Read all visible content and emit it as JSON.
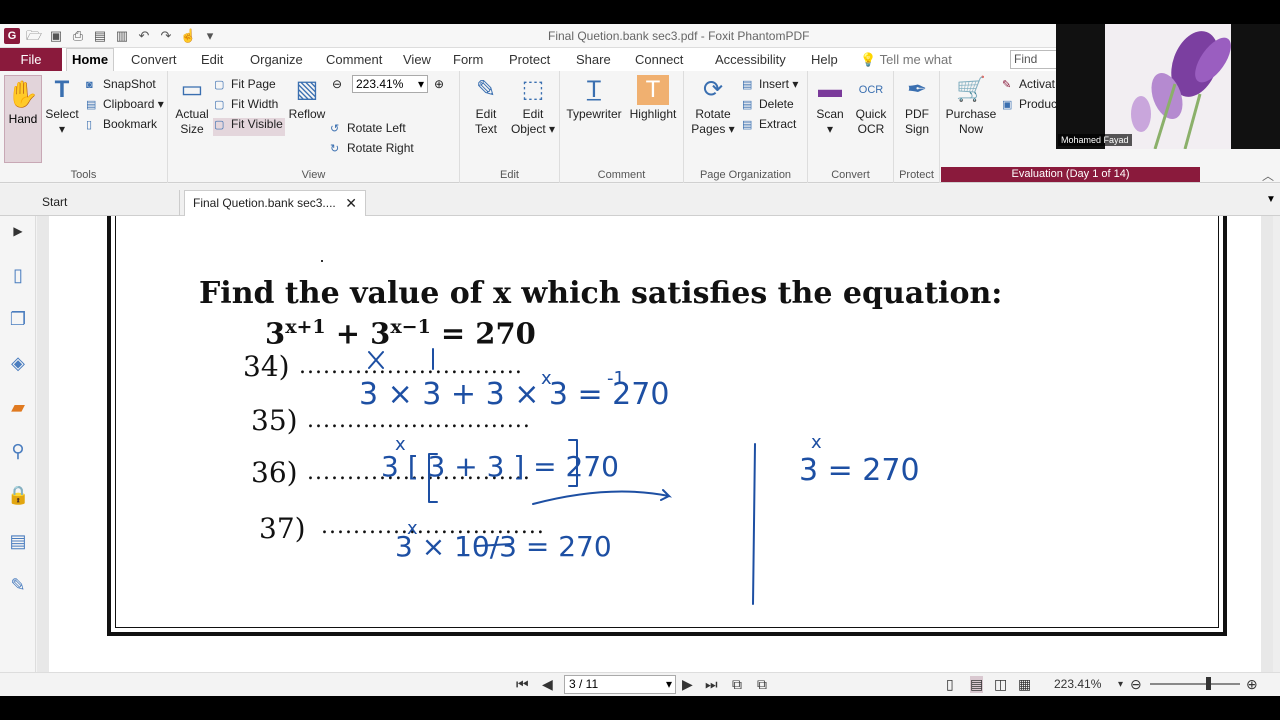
{
  "window": {
    "title": "Final Quetion.bank sec3.pdf - Foxit PhantomPDF"
  },
  "menu": {
    "file": "File",
    "home": "Home",
    "tabs": [
      "Convert",
      "Edit",
      "Organize",
      "Comment",
      "View",
      "Form",
      "Protect",
      "Share",
      "Connect",
      "Accessibility",
      "Help"
    ],
    "tell_me": "Tell me what",
    "find_placeholder": "Find"
  },
  "ribbon": {
    "tools": {
      "hand": "Hand",
      "select": "Select",
      "snapshot": "SnapShot",
      "clipboard": "Clipboard",
      "bookmark": "Bookmark",
      "label": "Tools"
    },
    "view": {
      "actual_size_1": "Actual",
      "actual_size_2": "Size",
      "fit_page": "Fit Page",
      "fit_width": "Fit Width",
      "fit_visible": "Fit Visible",
      "reflow": "Reflow",
      "zoom": "223.41%",
      "rotate_left": "Rotate Left",
      "rotate_right": "Rotate Right",
      "label": "View"
    },
    "edit": {
      "edit_text_1": "Edit",
      "edit_text_2": "Text",
      "edit_object_1": "Edit",
      "edit_object_2": "Object",
      "label": "Edit"
    },
    "comment": {
      "typewriter": "Typewriter",
      "highlight": "Highlight",
      "label": "Comment"
    },
    "page_org": {
      "rotate_pages_1": "Rotate",
      "rotate_pages_2": "Pages",
      "insert": "Insert",
      "delete": "Delete",
      "extract": "Extract",
      "label": "Page Organization"
    },
    "convert": {
      "scan": "Scan",
      "quick_ocr_1": "Quick",
      "quick_ocr_2": "OCR",
      "label": "Convert"
    },
    "protect": {
      "pdf_sign_1": "PDF",
      "pdf_sign_2": "Sign",
      "label": "Protect"
    },
    "purchase": {
      "line1": "Purchase",
      "line2": "Now",
      "activate": "Activat",
      "product": "Product",
      "evaluation": "Evaluation (Day 1 of 14)"
    }
  },
  "doc_tabs": {
    "start": "Start",
    "current": "Final Quetion.bank sec3...."
  },
  "document": {
    "question": "Find the value of x which satisfies the equation:",
    "eq_base1": "3",
    "eq_exp1": "x+1",
    "eq_plus": " + ",
    "eq_base2": "3",
    "eq_exp2": "x−1",
    "eq_rhs": "  = 270",
    "options": [
      "34)",
      "35)",
      "36)",
      "37)"
    ],
    "dots": "............................"
  },
  "handwriting": {
    "line1": "3 × 3   +   3 × 3   = 270",
    "line2": "3 [ 3 + 3 ]  = 270",
    "line3": "3 ×  10/3   = 270",
    "side": "3  = 270"
  },
  "status": {
    "page": "3 / 11",
    "zoom": "223.41%"
  },
  "webcam": {
    "name": "Mohamed Fayad"
  },
  "colors": {
    "brand": "#8a1a3c",
    "ink": "#1d4fa3"
  }
}
